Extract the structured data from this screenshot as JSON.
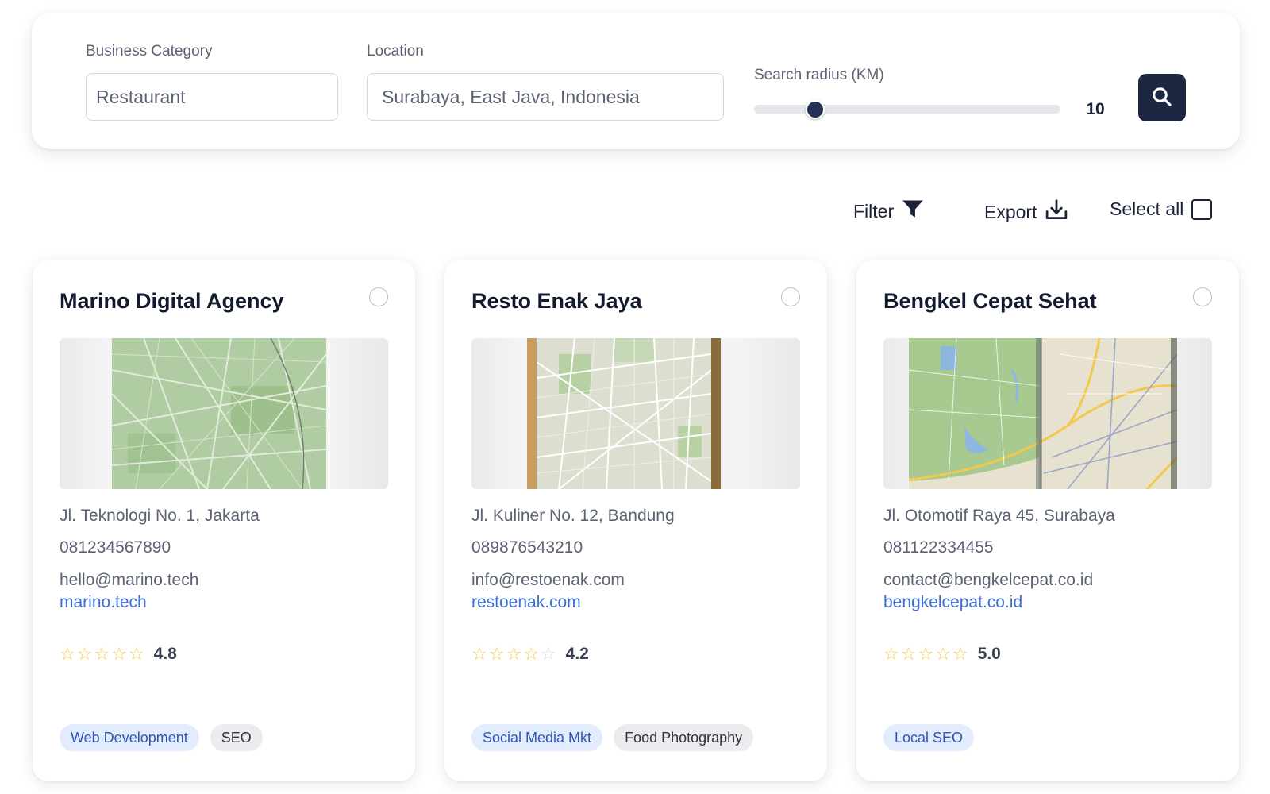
{
  "search": {
    "category_label": "Business Category",
    "category_value": "Restaurant",
    "location_label": "Location",
    "location_value": "Surabaya, East Java, Indonesia",
    "radius_label": "Search radius (KM)",
    "radius_value": "10",
    "radius_fraction": 0.2,
    "search_icon": "search-icon"
  },
  "toolbar": {
    "filter_label": "Filter",
    "filter_icon": "funnel-icon",
    "export_label": "Export",
    "export_icon": "download-icon",
    "select_all_label": "Select all"
  },
  "colors": {
    "accent_dark": "#1c2742",
    "link": "#3b70d8",
    "star": "#f2c94c",
    "tag_blue_bg": "#e3ecfc",
    "tag_gray_bg": "#ececee"
  },
  "cards": [
    {
      "name": "Marino Digital Agency",
      "address": "Jl. Teknologi No. 1, Jakarta",
      "phone": "081234567890",
      "email": "hello@marino.tech",
      "website": "marino.tech",
      "stars_filled": 5,
      "rating": "4.8",
      "tags": [
        {
          "label": "Web Development",
          "style": "blue"
        },
        {
          "label": "SEO",
          "style": "gray"
        }
      ]
    },
    {
      "name": "Resto Enak Jaya",
      "address": "Jl. Kuliner No. 12, Bandung",
      "phone": "089876543210",
      "email": "info@restoenak.com",
      "website": "restoenak.com",
      "stars_filled": 4,
      "rating": "4.2",
      "tags": [
        {
          "label": "Social Media Mkt",
          "style": "blue"
        },
        {
          "label": "Food Photography",
          "style": "gray"
        }
      ]
    },
    {
      "name": "Bengkel Cepat Sehat",
      "address": "Jl. Otomotif Raya 45, Surabaya",
      "phone": "081122334455",
      "email": "contact@bengkelcepat.co.id",
      "website": "bengkelcepat.co.id",
      "stars_filled": 5,
      "rating": "5.0",
      "tags": [
        {
          "label": "Local SEO",
          "style": "blue"
        }
      ]
    }
  ]
}
